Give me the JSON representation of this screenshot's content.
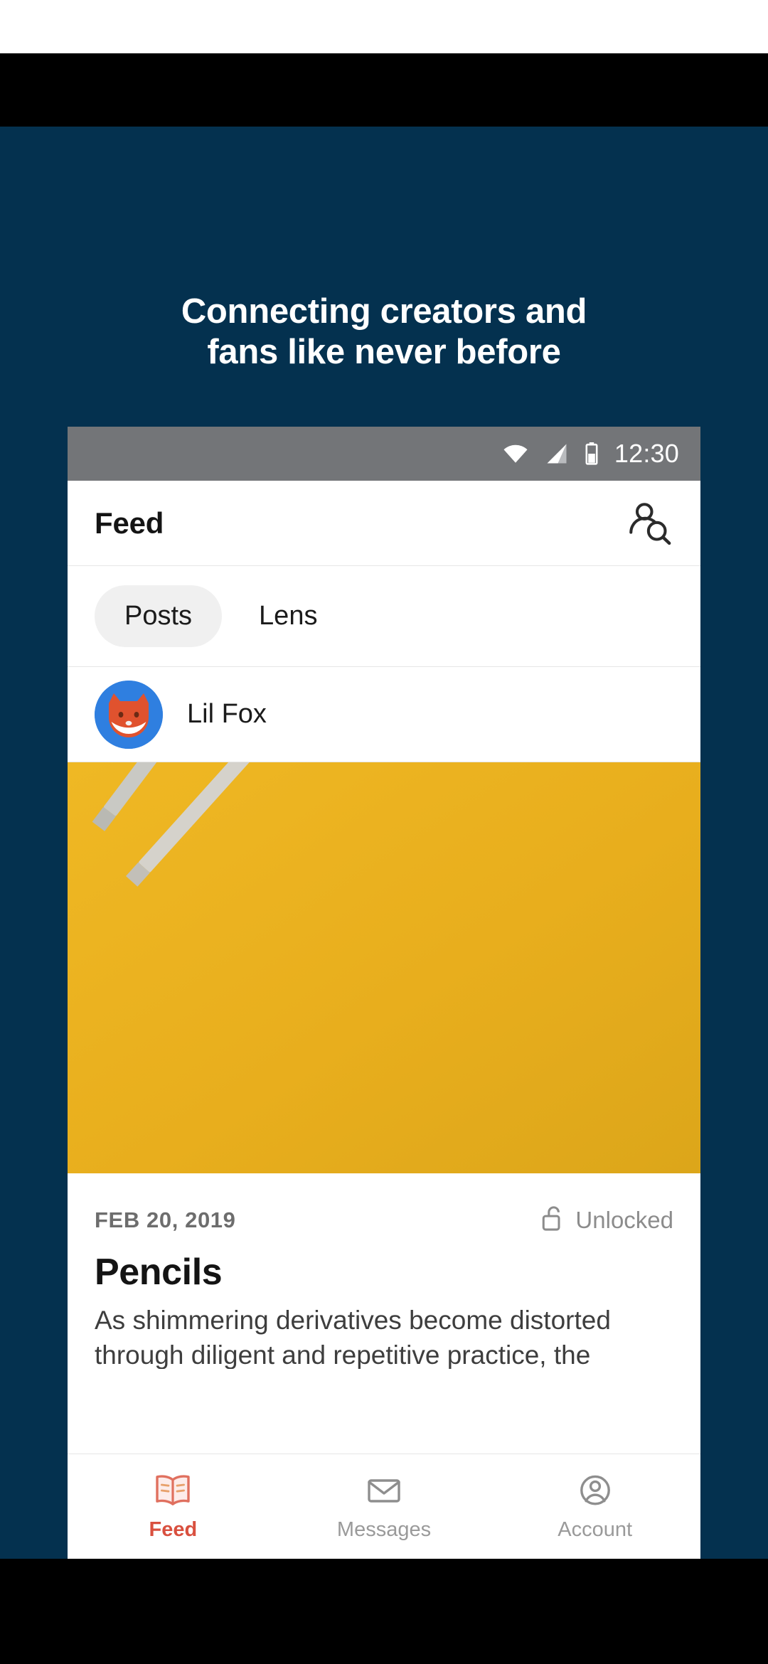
{
  "promo": {
    "background_color": "#04314f",
    "headline_line1": "Connecting creators and",
    "headline_line2": "fans like never before",
    "headline_color": "#ffffff"
  },
  "phone": {
    "status_bar": {
      "time": "12:30",
      "background_color": "#737578",
      "icons": [
        "wifi-icon",
        "cellular-signal-icon",
        "battery-icon"
      ]
    },
    "app_header": {
      "title": "Feed",
      "action_icon": "person-search-icon"
    },
    "tabs": [
      {
        "label": "Posts",
        "selected": true
      },
      {
        "label": "Lens",
        "selected": false
      }
    ],
    "author": {
      "name": "Lil Fox",
      "avatar_icon": "fox-avatar",
      "avatar_background": "#2f7fe0",
      "avatar_foreground": "#e0522e"
    },
    "post_image": {
      "description": "pencils-photo",
      "background_color": "#e9b01d"
    },
    "post": {
      "date": "FEB 20, 2019",
      "access_status": "Unlocked",
      "access_icon": "unlocked-padlock-icon",
      "title": "Pencils",
      "body": "As shimmering derivatives become distorted through diligent and repetitive practice, the"
    },
    "bottom_nav": [
      {
        "label": "Feed",
        "icon": "open-book-icon",
        "active": true,
        "color": "#d9503f"
      },
      {
        "label": "Messages",
        "icon": "envelope-icon",
        "active": false,
        "color": "#9a9a9a"
      },
      {
        "label": "Account",
        "icon": "account-circle-icon",
        "active": false,
        "color": "#9a9a9a"
      }
    ]
  }
}
